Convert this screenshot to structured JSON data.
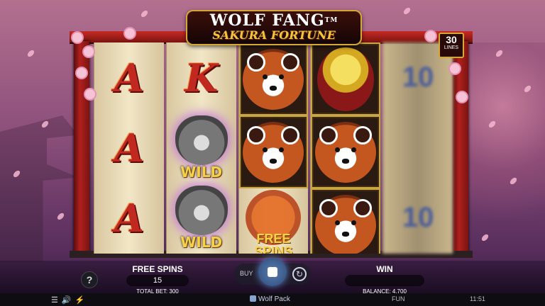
{
  "game": {
    "title_line1": "WOLF FANG",
    "title_tm": "TM",
    "title_line2": "SAKURA FORTUNE",
    "lines_count": "30",
    "lines_label": "LINES"
  },
  "reels": {
    "reel1": [
      "A",
      "A",
      "A"
    ],
    "reel2": [
      "K",
      "WILD",
      "WILD"
    ],
    "reel3": [
      "red-panda",
      "red-panda",
      "FREE SPINS"
    ],
    "reel4": [
      "crowned-crane",
      "red-panda",
      "red-panda"
    ],
    "reel5": [
      "10",
      "blurred",
      "10"
    ],
    "wild_label": "WILD",
    "free_spins_label_1": "FREE",
    "free_spins_label_2": "SPINS"
  },
  "hud": {
    "help_label": "?",
    "free_spins_label": "FREE SPINS",
    "free_spins_value": "15",
    "total_bet_text": "TOTAL BET: 300",
    "buy_label": "BUY",
    "win_label": "WIN",
    "win_value": "",
    "balance_text": "BALANCE: 4,700"
  },
  "bottombar": {
    "provider": "Wolf Pack",
    "mode": "FUN",
    "time": "11:51"
  },
  "icons": [
    "menu-icon",
    "sound-icon",
    "turbo-icon",
    "stop-icon",
    "autoplay-icon",
    "help-icon"
  ],
  "colors": {
    "accent_gold": "#d4a832",
    "gate_red": "#b0201d",
    "spin_blue": "#2b4a78"
  }
}
